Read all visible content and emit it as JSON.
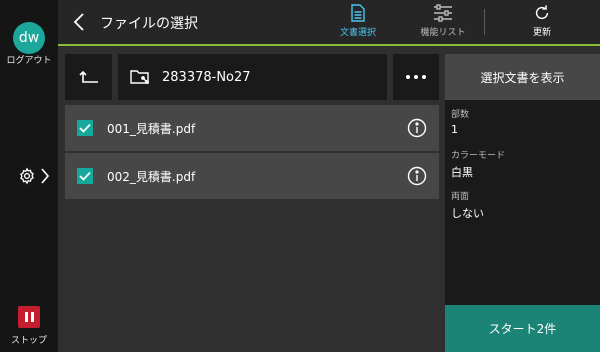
{
  "rail": {
    "avatar_initials": "dw",
    "logout_label": "ログアウト",
    "stop_label": "ストップ"
  },
  "header": {
    "title": "ファイルの選択",
    "tabs": [
      {
        "label": "文書選択",
        "icon": "document-icon",
        "active": true
      },
      {
        "label": "機能リスト",
        "icon": "sliders-icon",
        "active": false
      },
      {
        "label": "更新",
        "icon": "refresh-icon",
        "active": false
      }
    ]
  },
  "toolbar": {
    "folder_name": "283378-No27"
  },
  "files": [
    {
      "name": "001_見積書.pdf",
      "checked": true
    },
    {
      "name": "002_見積書.pdf",
      "checked": true
    }
  ],
  "side": {
    "show_button_label": "選択文書を表示",
    "properties": [
      {
        "label": "部数",
        "value": "1"
      },
      {
        "label": "カラーモード",
        "value": "白黒"
      },
      {
        "label": "両面",
        "value": "しない"
      }
    ],
    "start_button_label": "スタート2件"
  },
  "colors": {
    "accent_teal": "#16a89a",
    "active_tab": "#4cc6ee",
    "header_line": "#8bbf3a",
    "stop_red": "#c41e2e",
    "start_button": "#1b8477"
  }
}
